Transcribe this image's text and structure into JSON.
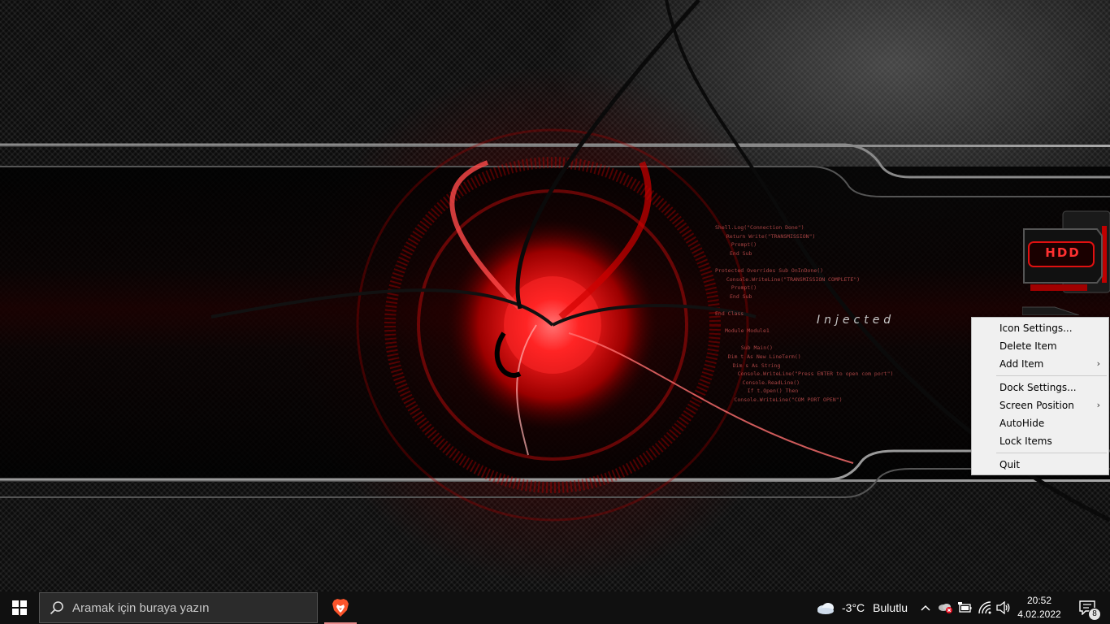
{
  "desktop": {
    "wallpaper_text": "Injected",
    "code_lines": [
      "Shell.Log(\"Connection Done\")",
      "  Return Write(\"TRANSMISSION\")",
      "  Prompt()",
      "End Sub",
      "",
      "Protected Overrides Sub OnInDone()",
      "  Console.WriteLine(\"TRANSMISSION COMPLETE\")",
      "  Prompt()",
      "End Sub",
      "",
      "End Class",
      "",
      "Module Module1",
      "",
      "  Sub Main()",
      "    Dim t As New LineTerm()",
      "    Dim s As String",
      "    Console.WriteLine(\"Press ENTER to open com port\")",
      "    Console.ReadLine()",
      "    If t.Open() Then",
      "      Console.WriteLine(\"COM PORT OPEN\")"
    ],
    "widget_label": "HDD"
  },
  "context_menu": {
    "items": [
      {
        "label": "Icon Settings...",
        "submenu": false
      },
      {
        "label": "Delete Item",
        "submenu": false
      },
      {
        "label": "Add Item",
        "submenu": true
      },
      {
        "separator": true
      },
      {
        "label": "Dock Settings...",
        "submenu": false
      },
      {
        "label": "Screen Position",
        "submenu": true
      },
      {
        "label": "AutoHide",
        "submenu": false
      },
      {
        "label": "Lock Items",
        "submenu": false
      },
      {
        "separator": true
      },
      {
        "label": "Quit",
        "submenu": false
      }
    ]
  },
  "taskbar": {
    "search_placeholder": "Aramak için buraya yazın",
    "pinned_app": "brave-browser-icon",
    "weather": {
      "temp": "-3°C",
      "condition": "Bulutlu",
      "icon": "cloud-icon"
    },
    "clock": {
      "time": "20:52",
      "date": "4.02.2022"
    },
    "notifications_count": "8"
  },
  "colors": {
    "taskbar_bg": "#101010",
    "menu_bg": "#f0f0f0",
    "accent_red": "#e00000"
  }
}
